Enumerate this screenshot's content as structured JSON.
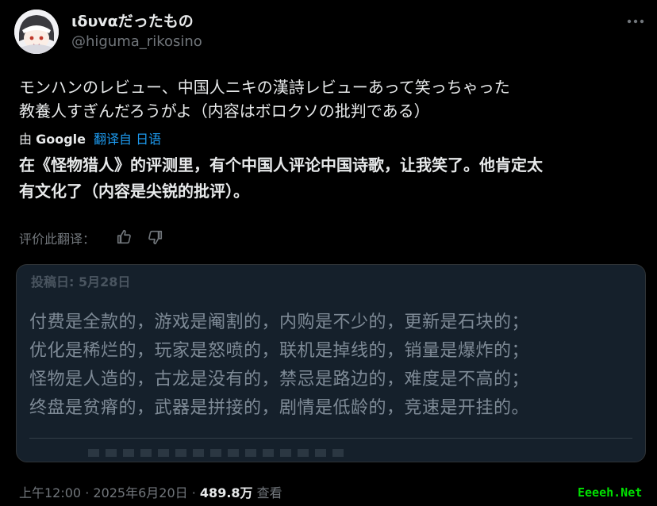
{
  "author": {
    "display_name": "ιδυvαだったもの",
    "handle": "@higuma_rikosino"
  },
  "tweet": {
    "lines": [
      "モンハンのレビュー、中国人ニキの漢詩レビューあって笑っちゃった",
      "教養人すぎんだろうがよ（内容はボロクソの批判である）"
    ]
  },
  "translation": {
    "by_prefix": "由",
    "by_provider": "Google",
    "link_label": "翻译自 日语",
    "lines": [
      "在《怪物猎人》的评测里，有个中国人评论中国诗歌，让我笑了。他肯定太",
      "有文化了（内容是尖锐的批评）。"
    ],
    "rate_label": "评价此翻译："
  },
  "card": {
    "date": "投稿日: 5月28日",
    "lines": [
      "付费是全款的，游戏是阉割的，内购是不少的，更新是石块的；",
      "优化是稀烂的，玩家是怒喷的，联机是掉线的，销量是爆炸的；",
      "怪物是人造的，古龙是没有的，禁忌是路边的，难度是不高的；",
      "终盘是贫瘠的，武器是拼接的，剧情是低龄的，竞速是开挂的。"
    ]
  },
  "meta": {
    "time": "上午12:00",
    "sep1": " · ",
    "date": "2025年6月20日",
    "sep2": " · ",
    "views_count": "489.8万",
    "views_label": "查看"
  },
  "watermark": "Eeeeh.Net",
  "icons": {
    "more": "more-horizontal-icon",
    "like": "thumbs-up-icon",
    "dislike": "thumbs-down-icon"
  },
  "colors": {
    "background": "#000000",
    "text": "#e7e9ea",
    "secondary": "#71767b",
    "link": "#1d9bf0",
    "card_bg": "#15202b",
    "watermark": "#00e000"
  }
}
